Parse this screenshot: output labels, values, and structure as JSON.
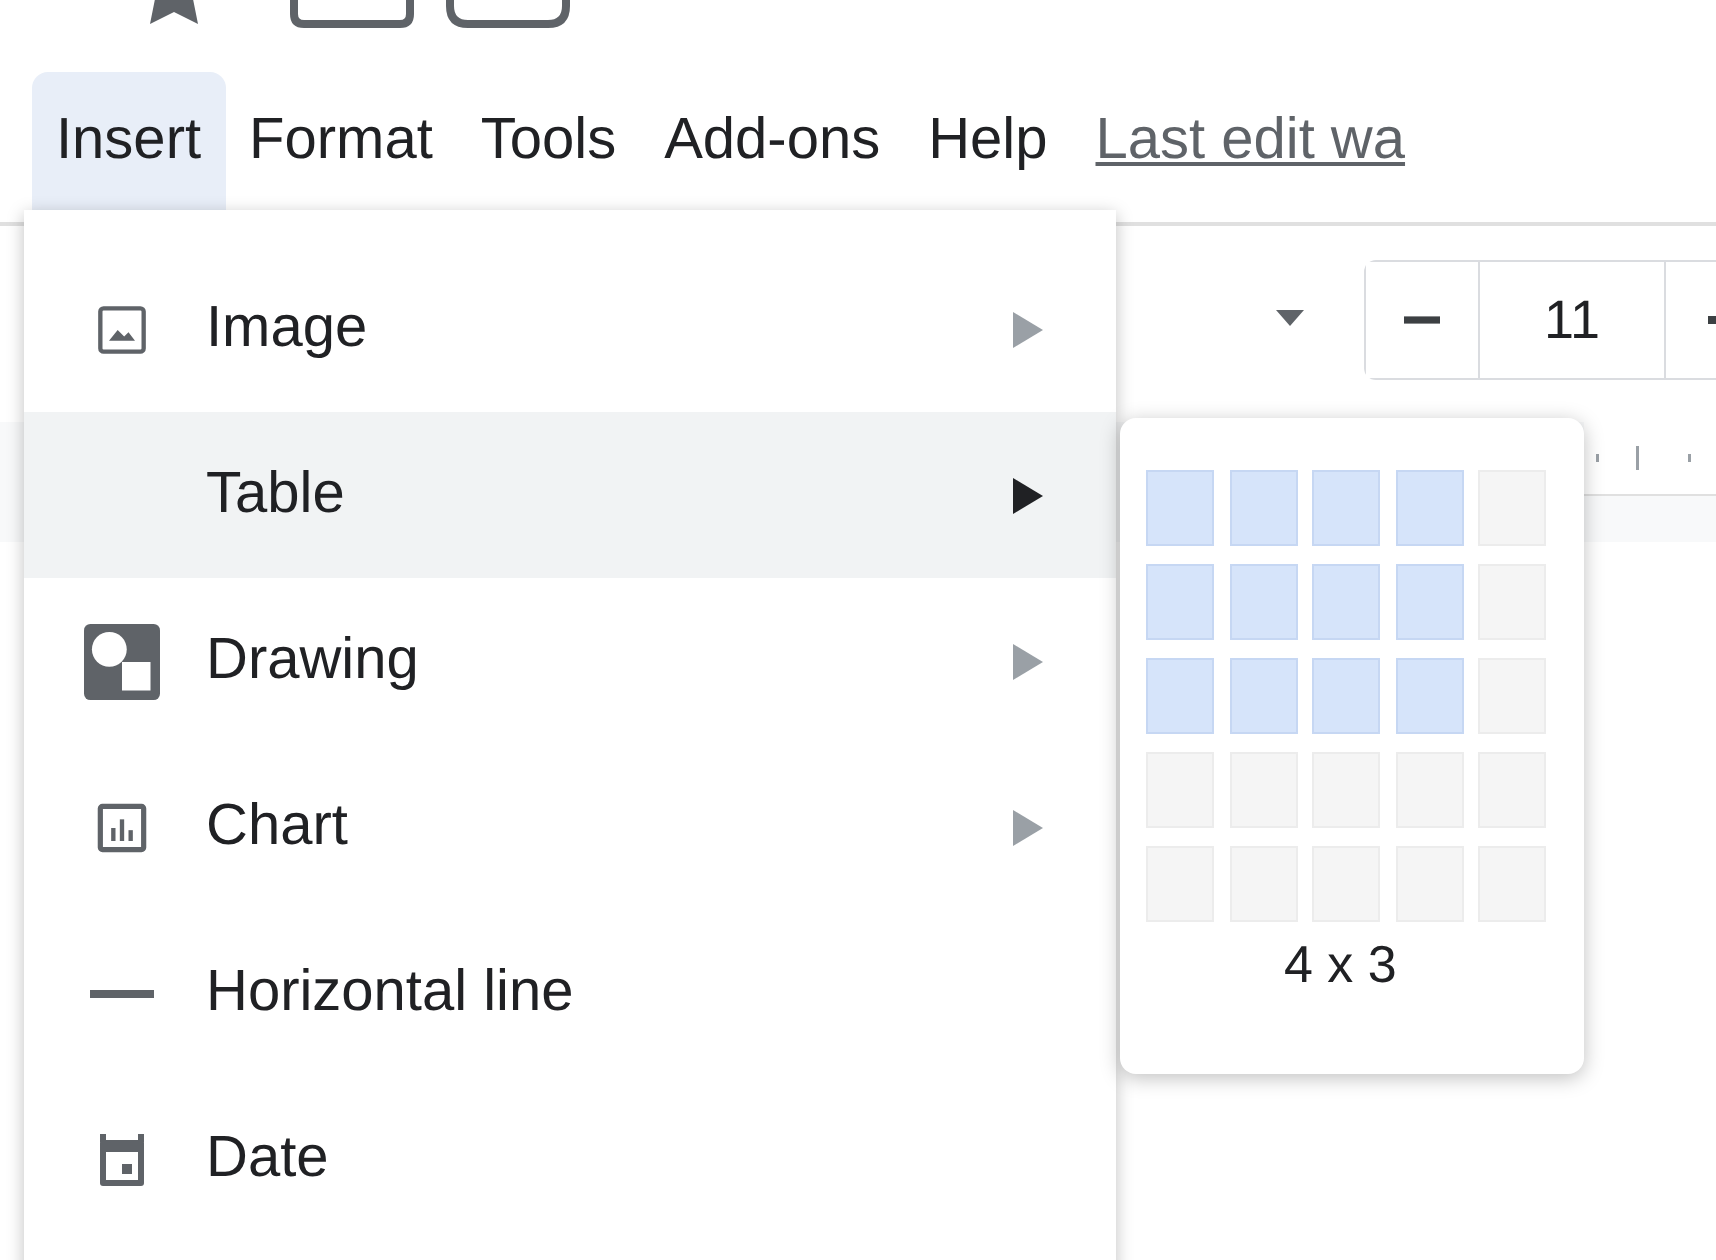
{
  "menu_bar": {
    "items": [
      {
        "label": "Insert",
        "selected": true
      },
      {
        "label": "Format",
        "selected": false
      },
      {
        "label": "Tools",
        "selected": false
      },
      {
        "label": "Add-ons",
        "selected": false
      },
      {
        "label": "Help",
        "selected": false
      }
    ],
    "last_edit_link": "Last edit wa"
  },
  "toolbar": {
    "font_size": "11"
  },
  "insert_menu": {
    "items": [
      {
        "label": "Image",
        "has_submenu": true,
        "selected": false
      },
      {
        "label": "Table",
        "has_submenu": true,
        "selected": true
      },
      {
        "label": "Drawing",
        "has_submenu": true,
        "selected": false
      },
      {
        "label": "Chart",
        "has_submenu": true,
        "selected": false
      },
      {
        "label": "Horizontal line",
        "has_submenu": false,
        "selected": false
      },
      {
        "label": "Date",
        "has_submenu": false,
        "selected": false
      }
    ]
  },
  "table_picker": {
    "rows": [
      [
        {
          "selected": true
        },
        {
          "selected": true
        },
        {
          "selected": true
        },
        {
          "selected": true
        },
        {
          "selected": false
        }
      ],
      [
        {
          "selected": true
        },
        {
          "selected": true
        },
        {
          "selected": true
        },
        {
          "selected": true
        },
        {
          "selected": false
        }
      ],
      [
        {
          "selected": true
        },
        {
          "selected": true
        },
        {
          "selected": true
        },
        {
          "selected": true
        },
        {
          "selected": false
        }
      ],
      [
        {
          "selected": false
        },
        {
          "selected": false
        },
        {
          "selected": false
        },
        {
          "selected": false
        },
        {
          "selected": false
        }
      ],
      [
        {
          "selected": false
        },
        {
          "selected": false
        },
        {
          "selected": false
        },
        {
          "selected": false
        },
        {
          "selected": false
        }
      ]
    ],
    "size_label": "4 x 3"
  }
}
